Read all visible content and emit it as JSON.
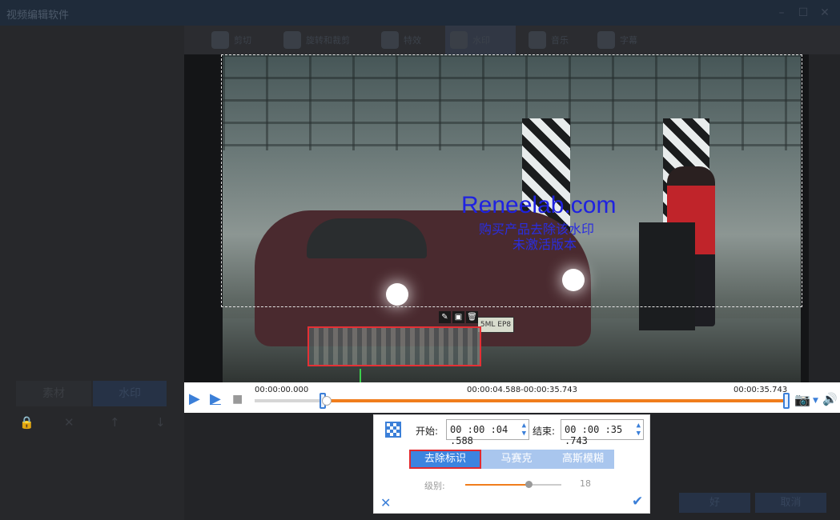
{
  "window": {
    "title": "视频编辑软件",
    "controls": [
      "–",
      "☐",
      "✕"
    ]
  },
  "toolbar": {
    "items": [
      {
        "label": "剪切",
        "icon": "scissors-icon"
      },
      {
        "label": "旋转和裁剪",
        "icon": "crop-icon"
      },
      {
        "label": "特效",
        "icon": "effects-icon"
      },
      {
        "label": "水印",
        "icon": "film-reel-icon",
        "active": true
      },
      {
        "label": "音乐",
        "icon": "music-note-icon"
      },
      {
        "label": "字幕",
        "icon": "subtitle-icon"
      }
    ]
  },
  "left_panel": {
    "tabs": [
      "素材",
      "水印"
    ],
    "icons": [
      "lock-icon",
      "delete-icon",
      "up-arrow-icon",
      "down-arrow-icon"
    ]
  },
  "preview": {
    "watermark_line1": "Reneelab.com",
    "watermark_line2": "购买产品去除该水印",
    "watermark_line3": "未激活版本",
    "plate_text": "5ML EP8"
  },
  "timeline": {
    "start_time": "00:00:00.000",
    "range": "00:00:04.588-00:00:35.743",
    "end_time": "00:00:35.743",
    "selection_start_fraction": 0.128,
    "selection_end_fraction": 1.0
  },
  "panel": {
    "start_label": "开始:",
    "start_value": "00 :00 :04 .588",
    "end_label": "结束:",
    "end_value": "00 :00 :35 .743",
    "modes": [
      "去除标识",
      "马赛克",
      "高斯模糊"
    ],
    "selected_mode": "去除标识",
    "level_label": "级别:",
    "level_value": "18",
    "level_fraction": 0.66
  },
  "footer": {
    "ok_label": "好",
    "cancel_label": "取消"
  },
  "colors": {
    "accent": "#3b7fd8",
    "progress": "#f07d1c",
    "highlight": "#e02a30"
  }
}
